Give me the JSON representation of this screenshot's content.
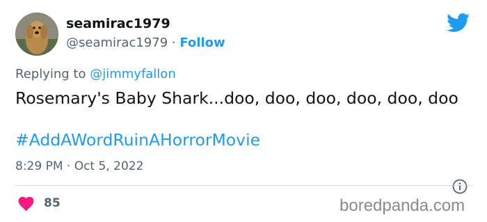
{
  "author": {
    "name": "seamirac1979",
    "handle": "@seamirac1979",
    "separator": "·",
    "follow_label": "Follow",
    "avatar_icon": "dog-avatar"
  },
  "reply": {
    "prefix": "Replying to",
    "mention": "@jimmyfallon"
  },
  "tweet": {
    "text": "Rosemary's Baby Shark...doo, doo, doo, doo, doo, doo",
    "hashtag": "#AddAWordRuinAHorrorMovie",
    "timestamp": "8:29 PM · Oct 5, 2022"
  },
  "engagement": {
    "likes": "85",
    "like_icon": "heart-icon",
    "like_color": "#f91880"
  },
  "brand": {
    "twitter_icon": "twitter-bird-icon",
    "twitter_color": "#1d9bf0",
    "watermark": "boredpanda.com"
  },
  "colors": {
    "link": "#1d9bf0",
    "muted": "#536471",
    "text": "#0f1419"
  }
}
